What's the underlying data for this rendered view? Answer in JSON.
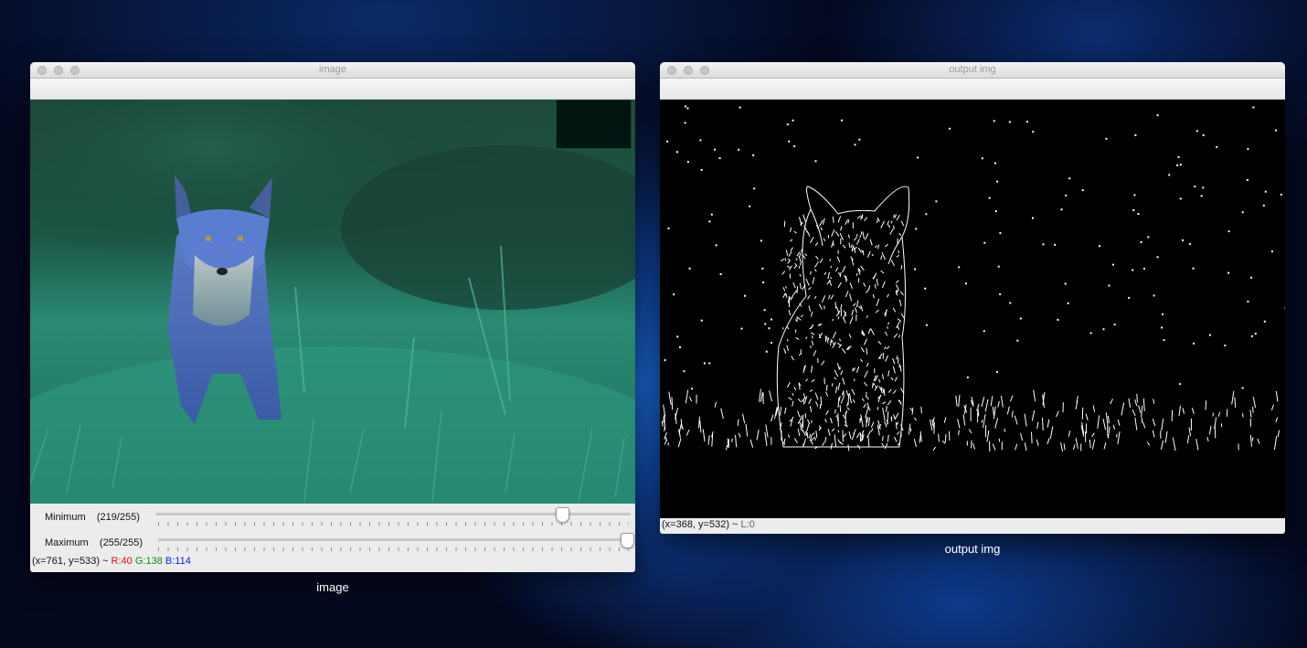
{
  "windows": {
    "left": {
      "title": "image",
      "caption": "image",
      "trackbars": [
        {
          "label": "Minimum",
          "value_text": "(219/255)",
          "value": 219,
          "max": 255
        },
        {
          "label": "Maximum",
          "value_text": "(255/255)",
          "value": 255,
          "max": 255
        }
      ],
      "status": {
        "coords": "(x=761, y=533) ~",
        "r": "R:40",
        "g": "G:138",
        "b": "B:114"
      }
    },
    "right": {
      "title": "output img",
      "caption": "output img",
      "status": {
        "coords": "(x=368, y=532) ~",
        "l": "L:0"
      }
    }
  },
  "colors": {
    "r": "#e01010",
    "g": "#108a10",
    "b": "#1020e0"
  },
  "icons": {
    "traffic_lights": [
      "close-button-icon",
      "minimize-button-icon",
      "zoom-button-icon"
    ]
  }
}
